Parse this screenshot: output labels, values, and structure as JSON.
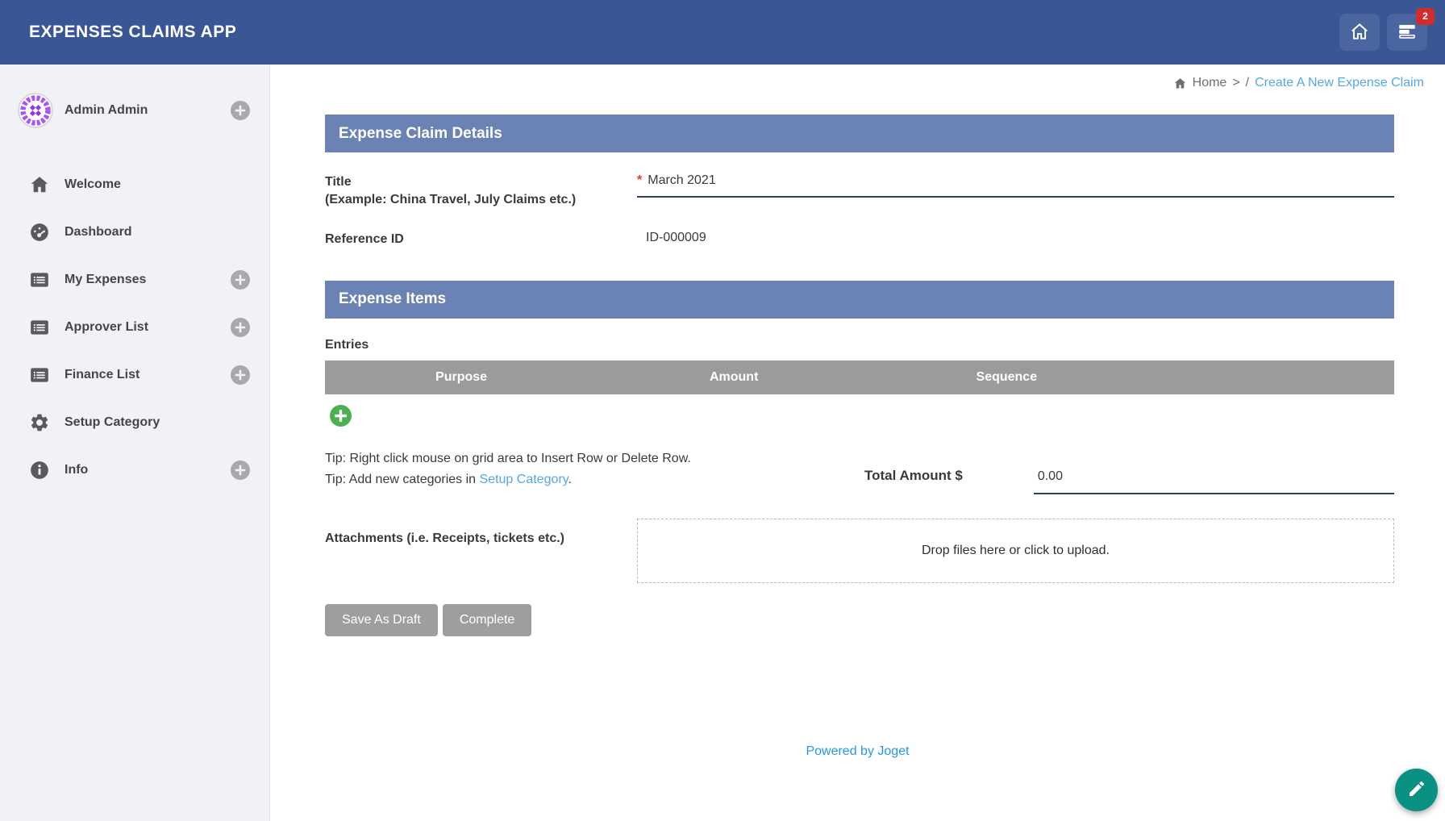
{
  "header": {
    "app_title": "EXPENSES CLAIMS APP",
    "notification_count": "2"
  },
  "sidebar": {
    "user": {
      "name": "Admin Admin"
    },
    "items": [
      {
        "label": "Welcome",
        "icon": "home-icon",
        "has_add": false
      },
      {
        "label": "Dashboard",
        "icon": "dashboard-icon",
        "has_add": false
      },
      {
        "label": "My Expenses",
        "icon": "list-icon",
        "has_add": true
      },
      {
        "label": "Approver List",
        "icon": "list-icon",
        "has_add": true
      },
      {
        "label": "Finance List",
        "icon": "list-icon",
        "has_add": true
      },
      {
        "label": "Setup Category",
        "icon": "gear-icon",
        "has_add": false
      },
      {
        "label": "Info",
        "icon": "info-icon",
        "has_add": true
      }
    ]
  },
  "breadcrumb": {
    "home": "Home",
    "separator1": ">",
    "separator2": "/",
    "current": "Create A New Expense Claim"
  },
  "form": {
    "section1_title": "Expense Claim Details",
    "title_label_line1": "Title",
    "title_label_line2": "(Example: China Travel, July Claims etc.)",
    "title_required_mark": "*",
    "title_value": "March 2021",
    "reference_label": "Reference ID",
    "reference_value": "ID-000009",
    "section2_title": "Expense Items",
    "entries_label": "Entries",
    "grid_columns": [
      "Purpose",
      "Amount",
      "Sequence"
    ],
    "tip1": "Tip: Right click mouse on grid area to Insert Row or Delete Row.",
    "tip2_prefix": "Tip: Add new categories in ",
    "tip2_link": "Setup Category",
    "tip2_suffix": ".",
    "total_label": "Total Amount $",
    "total_value": "0.00",
    "attachments_label": "Attachments (i.e. Receipts, tickets etc.)",
    "dropzone_text": "Drop files here or click to upload.",
    "save_draft_label": "Save As Draft",
    "complete_label": "Complete"
  },
  "footer": {
    "powered_by": "Powered by Joget"
  },
  "colors": {
    "header_blue": "#3a5795",
    "section_blue": "#6b82b5",
    "grid_gray": "#9b9b9b",
    "link_blue": "#54a7e9",
    "joget_blue": "#2196f3",
    "underline_navy": "#2d3e63",
    "badge_red": "#d22d2d",
    "add_green": "#4caf50",
    "fab_teal": "#0a9184",
    "button_gray": "#9e9e9e",
    "sidebar_bg": "#f1f2f6",
    "required_red": "#e53935",
    "avatar_purple": "#a855f7"
  }
}
